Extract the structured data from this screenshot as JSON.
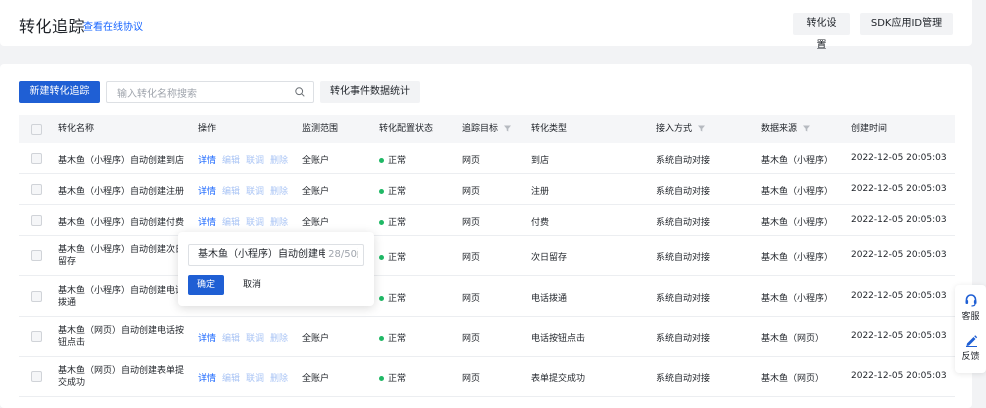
{
  "header": {
    "title": "转化追踪",
    "protocol_link": "查看在线协议",
    "settings_button": "转化设置",
    "sdk_button": "SDK应用ID管理"
  },
  "toolbar": {
    "new_button": "新建转化追踪",
    "search_placeholder": "输入转化名称搜索",
    "stats_button": "转化事件数据统计"
  },
  "table": {
    "columns": [
      "转化名称",
      "操作",
      "监测范围",
      "转化配置状态",
      "追踪目标",
      "转化类型",
      "接入方式",
      "数据来源",
      "创建时间"
    ],
    "actions": [
      "详情",
      "编辑",
      "联调",
      "删除"
    ],
    "rows": [
      {
        "name": "基木鱼（小程序）自动创建到店",
        "scope": "全账户",
        "status": "正常",
        "target": "网页",
        "type": "到店",
        "access": "系统自动对接",
        "source": "基木鱼（小程序）",
        "created": "2022-12-05 20:05:03"
      },
      {
        "name": "基木鱼（小程序）自动创建注册",
        "scope": "全账户",
        "status": "正常",
        "target": "网页",
        "type": "注册",
        "access": "系统自动对接",
        "source": "基木鱼（小程序）",
        "created": "2022-12-05 20:05:03"
      },
      {
        "name": "基木鱼（小程序）自动创建付费",
        "scope": "全账户",
        "status": "正常",
        "target": "网页",
        "type": "付费",
        "access": "系统自动对接",
        "source": "基木鱼（小程序）",
        "created": "2022-12-05 20:05:03"
      },
      {
        "name": "基木鱼（小程序）自动创建次日留存",
        "scope": "",
        "status": "正常",
        "target": "网页",
        "type": "次日留存",
        "access": "系统自动对接",
        "source": "基木鱼（小程序）",
        "created": "2022-12-05 20:05:03"
      },
      {
        "name": "基木鱼（小程序）自动创建电话拨通",
        "scope": "",
        "status": "正常",
        "target": "网页",
        "type": "电话拨通",
        "access": "系统自动对接",
        "source": "基木鱼（小程序）",
        "created": "2022-12-05 20:05:03"
      },
      {
        "name": "基木鱼（网页）自动创建电话按钮点击",
        "scope": "全账户",
        "status": "正常",
        "target": "网页",
        "type": "电话按钮点击",
        "access": "系统自动对接",
        "source": "基木鱼（网页）",
        "created": "2022-12-05 20:05:03"
      },
      {
        "name": "基木鱼（网页）自动创建表单提交成功",
        "scope": "全账户",
        "status": "正常",
        "target": "网页",
        "type": "表单提交成功",
        "access": "系统自动对接",
        "source": "基木鱼（网页）",
        "created": "2022-12-05 20:05:03"
      }
    ]
  },
  "popover": {
    "input_value": "基木鱼（小程序）自动创建电话拨通",
    "char_count": "28/50",
    "confirm": "确定",
    "cancel": "取消"
  },
  "side_float": {
    "service": "客服",
    "feedback": "反馈"
  },
  "colors": {
    "primary": "#1f5fd4",
    "link": "#1664ff",
    "status_ok": "#1fb865"
  }
}
